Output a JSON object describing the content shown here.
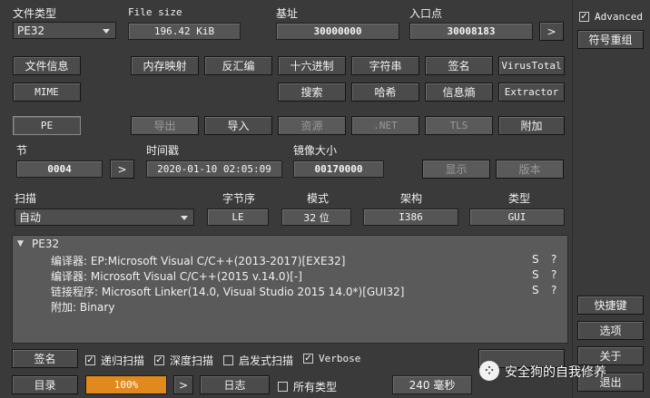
{
  "file_type": {
    "label": "文件类型",
    "value": "PE32"
  },
  "file_size": {
    "label": "File size",
    "value": "196.42 KiB"
  },
  "base_addr": {
    "label": "基址",
    "value": "30000000"
  },
  "entry_point": {
    "label": "入口点",
    "value": "30008183",
    "go": ">"
  },
  "advanced": {
    "label": "Advanced",
    "checked": true
  },
  "right_panel": {
    "symbol_reorg": "符号重组",
    "shortcuts": "快捷键",
    "options": "选项",
    "about": "关于",
    "exit": "退出"
  },
  "toolbar_row1": [
    "文件信息",
    "内存映射",
    "反汇编",
    "十六进制",
    "字符串",
    "签名",
    "VirusTotal"
  ],
  "toolbar_row2": [
    "MIME",
    "搜索",
    "哈希",
    "信息熵",
    "Extractor"
  ],
  "pe_row": {
    "pe": "PE",
    "export": "导出",
    "import": "导入",
    "resource": "资源",
    "net": ".NET",
    "tls": "TLS",
    "overlay": "附加"
  },
  "section": {
    "label": "节",
    "value": "0004",
    "go": ">"
  },
  "timestamp": {
    "label": "时间戳",
    "value": "2020-01-10 02:05:09"
  },
  "image_size": {
    "label": "镜像大小",
    "value": "00170000"
  },
  "show_btn": "显示",
  "version_btn": "版本",
  "scan": {
    "label": "扫描",
    "value": "自动"
  },
  "endian": {
    "label": "字节序",
    "value": "LE"
  },
  "mode": {
    "label": "模式",
    "value": "32 位"
  },
  "arch": {
    "label": "架构",
    "value": "I386"
  },
  "type": {
    "label": "类型",
    "value": "GUI"
  },
  "results": {
    "root": "PE32",
    "items": [
      {
        "text": "编译器: EP:Microsoft Visual C/C++(2013-2017)[EXE32]",
        "s": "S",
        "q": "?"
      },
      {
        "text": "编译器: Microsoft Visual C/C++(2015 v.14.0)[-]",
        "s": "S",
        "q": "?"
      },
      {
        "text": "链接程序: Microsoft Linker(14.0, Visual Studio 2015 14.0*)[GUI32]",
        "s": "S",
        "q": "?"
      },
      {
        "text": "附加: Binary",
        "s": "",
        "q": ""
      }
    ]
  },
  "bottom": {
    "signature": "签名",
    "recursive": {
      "label": "递归扫描",
      "checked": true
    },
    "deep": {
      "label": "深度扫描",
      "checked": true
    },
    "heuristic": {
      "label": "启发式扫描",
      "checked": false
    },
    "verbose": {
      "label": "Verbose",
      "checked": true
    },
    "directory": "目录",
    "progress": "100%",
    "progress_value": 1.0,
    "go": ">",
    "log": "日志",
    "all_types": {
      "label": "所有类型",
      "checked": false
    },
    "time": "240 毫秒"
  },
  "watermark": "安全狗的自我修养",
  "colors": {
    "background": "#3a3a3a",
    "progress": "#e08a1e",
    "panel": "#5a5a5a"
  }
}
